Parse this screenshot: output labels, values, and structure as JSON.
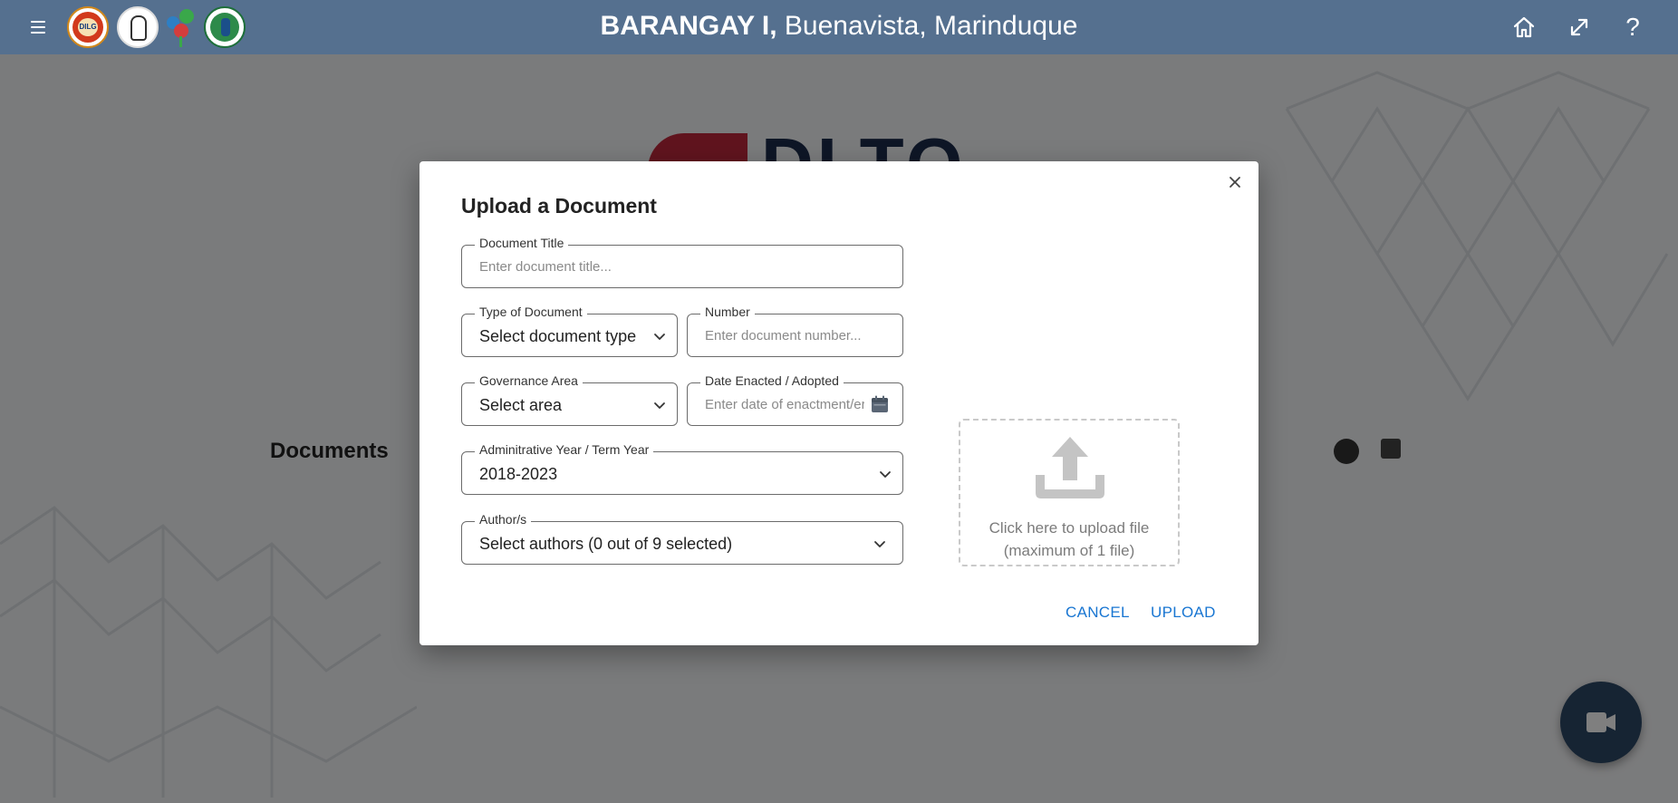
{
  "header": {
    "title_bold": "BARANGAY I,",
    "title_rest": " Buenavista, Marinduque",
    "logo1_text": "DILG"
  },
  "background": {
    "logo_text": "DLTO",
    "section_title": "Documents"
  },
  "dialog": {
    "title": "Upload a Document",
    "fields": {
      "document_title": {
        "label": "Document Title",
        "placeholder": "Enter document title...",
        "value": ""
      },
      "type_of_document": {
        "label": "Type of Document",
        "value": "Select document type"
      },
      "number": {
        "label": "Number",
        "placeholder": "Enter document number...",
        "value": ""
      },
      "governance_area": {
        "label": "Governance Area",
        "value": "Select area"
      },
      "date_enacted": {
        "label": "Date Enacted / Adopted",
        "placeholder": "Enter date of enactment/er",
        "value": ""
      },
      "administrative_year": {
        "label": "Adminitrative Year / Term Year",
        "value": "2018-2023"
      },
      "authors": {
        "label": "Author/s",
        "value": "Select authors (0 out of 9 selected)"
      }
    },
    "upload": {
      "line1": "Click here to upload file",
      "line2": "(maximum of 1 file)"
    },
    "actions": {
      "cancel": "CANCEL",
      "upload": "UPLOAD"
    }
  },
  "icons": {
    "menu": "menu-icon",
    "home": "home-icon",
    "fullscreen": "expand-icon",
    "help": "help-icon",
    "close": "close-icon",
    "dropdown": "chevron-down-icon",
    "calendar": "calendar-icon",
    "upload": "upload-icon",
    "fab": "video-icon"
  },
  "colors": {
    "header": "#55708f",
    "link": "#1976d2",
    "fab": "#2d4867"
  },
  "help_glyph": "?"
}
